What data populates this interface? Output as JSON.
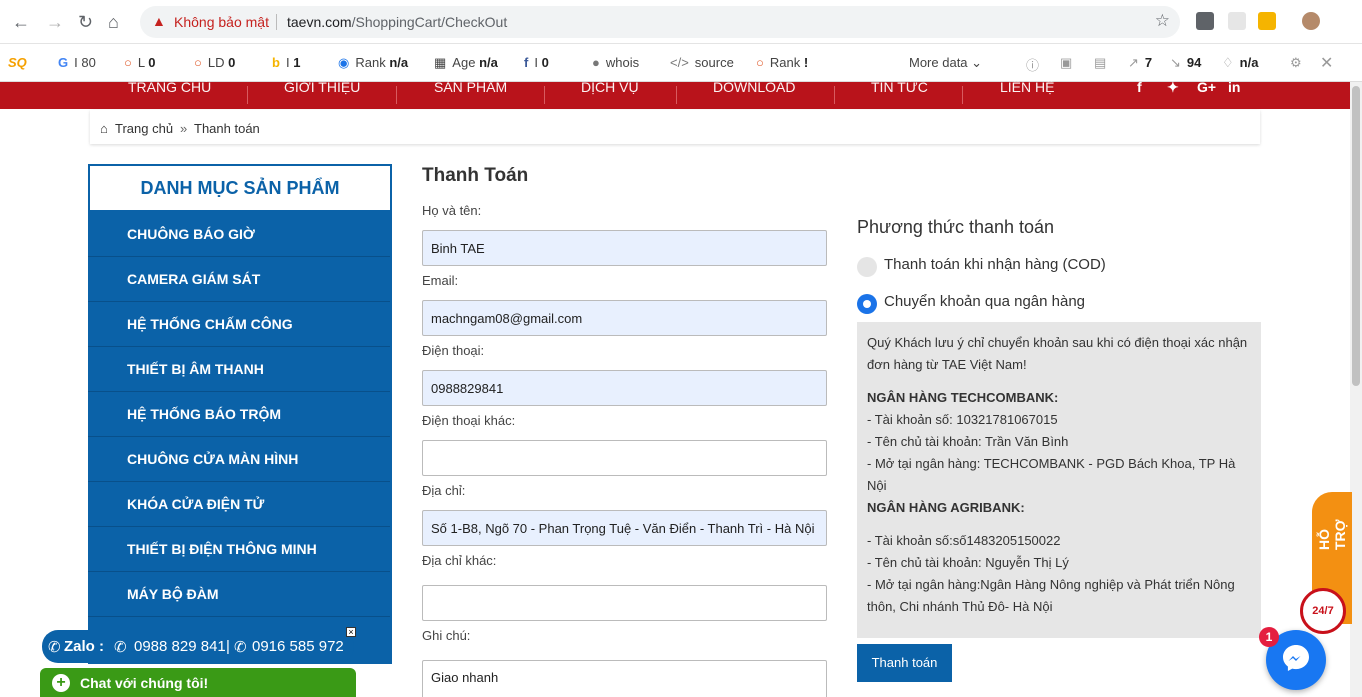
{
  "browser": {
    "security_warning": "Không bảo mật",
    "url_host": "taevn.com",
    "url_path": "/ShoppingCart/CheckOut"
  },
  "seo_toolbar": {
    "google": "80",
    "links": "0",
    "ld": "0",
    "bing": "1",
    "rank_label": "Rank",
    "rank_value": "n/a",
    "age_label": "Age",
    "age_value": "n/a",
    "facebook": "0",
    "whois": "whois",
    "source": "source",
    "rank2_label": "Rank",
    "rank2_value": "!",
    "more_data": "More data",
    "ext_links": "7",
    "int_links": "94",
    "diamond": "n/a"
  },
  "site_menu": [
    "TRANG CHỦ",
    "GIỚI THIỆU",
    "SẢN PHẨM",
    "DỊCH VỤ",
    "DOWNLOAD",
    "TIN TỨC",
    "LIÊN HỆ"
  ],
  "breadcrumb": {
    "home": "Trang chủ",
    "current": "Thanh toán"
  },
  "sidebar": {
    "title": "DANH MỤC SẢN PHẨM",
    "items": [
      "CHUÔNG BÁO GIỜ",
      "CAMERA GIÁM SÁT",
      "HỆ THỐNG CHẤM CÔNG",
      "THIẾT BỊ ÂM THANH",
      "HỆ THỐNG BÁO TRỘM",
      "CHUÔNG CỬA MÀN HÌNH",
      "KHÓA CỬA ĐIỆN TỬ",
      "THIẾT BỊ ĐIỆN THÔNG MINH",
      "MÁY BỘ ĐÀM"
    ]
  },
  "form": {
    "title": "Thanh Toán",
    "name_label": "Họ và tên:",
    "name_value": "Binh TAE",
    "email_label": "Email:",
    "email_value": "machngam08@gmail.com",
    "phone_label": "Điện thoại:",
    "phone_value": "0988829841",
    "phone2_label": "Điện thoại khác:",
    "phone2_value": "",
    "address_label": "Địa chỉ:",
    "address_value": "Số 1-B8, Ngõ 70 - Phan Trọng Tuệ - Văn Điển - Thanh Trì - Hà Nội",
    "address2_label": "Địa chỉ khác:",
    "address2_value": "",
    "note_label": "Ghi chú:",
    "note_value": "Giao nhanh"
  },
  "payment": {
    "title": "Phương thức thanh toán",
    "option_cod": "Thanh toán khi nhận hàng (COD)",
    "option_bank": "Chuyển khoản qua ngân hàng",
    "selected": "bank",
    "notice_line1": "Quý Khách lưu ý chỉ chuyển khoản sau khi có điện thoại xác nhận",
    "notice_line2": "đơn hàng từ TAE Việt Nam!",
    "bank1_title": "NGÂN HÀNG TECHCOMBANK:",
    "bank1_account": "- Tài khoản số: 10321781067015",
    "bank1_owner": "- Tên chủ tài khoản: Trần Văn Bình",
    "bank1_branch_line1": "- Mở tại ngân hàng: TECHCOMBANK - PGD Bách Khoa, TP Hà",
    "bank1_branch_line2": "Nội",
    "bank2_title": "NGÂN HÀNG AGRIBANK:",
    "bank2_account": "- Tài khoản số:số1483205150022",
    "bank2_owner": "- Tên chủ tài khoản: Nguyễn Thị Lý",
    "bank2_branch_line1": "- Mở tại ngân hàng:Ngân Hàng Nông nghiệp và Phát triển Nông",
    "bank2_branch_line2": "thôn, Chi nhánh Thủ Đô- Hà Nội",
    "submit_label": "Thanh toán"
  },
  "floating": {
    "zalo_label": "Zalo :",
    "zalo_phone1": "0988 829 841",
    "zalo_sep": "|",
    "zalo_phone2": "0916 585 972",
    "chat_label": "Chat với chúng tôi!",
    "support_label": "HỖ TRỢ",
    "support_247": "24/7",
    "messenger_badge": "1"
  },
  "colors": {
    "brand_red": "#b9131b",
    "brand_blue": "#0b62a8",
    "chat_green": "#3a9a16",
    "support_orange": "#f39012",
    "messenger_blue": "#1877f2"
  }
}
